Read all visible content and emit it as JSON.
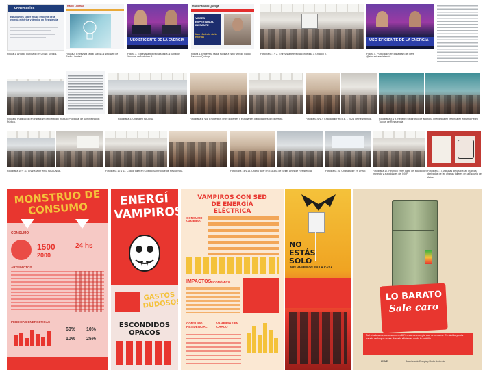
{
  "row1": {
    "captions": [
      "Figura 1. Artículo publicado en UNNE Medios.",
      "Figura 2. Entrevista radial subida al sitio web de Radio Libertad.",
      "Figura 3. Entrevista televisiva subida al canal de Youtube de Noticiero 9.",
      "Figura 4. Entrevista radial subida al sitio web de Radio Facundo Quiroga.",
      "Fotografía 1 y 2. Entrevista televisiva concedida a Chaco TV.",
      "Figura 5. Publicación en Instagram del perfil @elmundiaresistencia."
    ],
    "tv_banner": "USO EFICIENTE DE LA ENERGÍA",
    "tv_banner_2": "USO EFICIENTE DE LA ENERGÍA",
    "web_logo": "unnemedios",
    "web_headline": "Estudiantes sobre el uso eficiente de la energía eléctrica y térmica en Resistencia",
    "radio_badge": "VOCES EXPERTAS AL INSTANTE",
    "radio_headline": "Uso eficiente de la energía",
    "radio_site": "Radio Libertad",
    "radio4_site": "Radio Facundo Quiroga"
  },
  "row2": {
    "captions": [
      "Figura 6. Publicación en Instagram del perfil del Instituto Provincial de Administración Pública.",
      "Fotografía 3. Charla en FAD y U.",
      "Fotografía 4, y 5. Encuentros entre docentes y estudiantes participantes del proyecto.",
      "Fotografía 6 y 7. Charla taller en E.E.T. N°24 de Resistencia.",
      "Fotografía 8 y 9. Registro fotográfico de auditoría energética en vivienda en el barrio Pedro Turcus de Resistencia."
    ]
  },
  "row3": {
    "captions": [
      "Fotografía 10 y 11. Charla taller en la FAU UNNE.",
      "Fotografía 12 y 13. Charla taller en Colegio San Roque de Resistencia.",
      "Fotografía 14 y 15. Charla taller en Escuela de Bellas Artes de Resistencia.",
      "Fotografía 16. Charla taller en UNNE.",
      "Fotografía 17. Reunión entre parte del equipo del proyecto y autoridades del INVP.",
      "Fotografía 17. Algunas de las piezas gráficas derivadas de las charlas talleres en la Escuela de Artes."
    ]
  },
  "posters": {
    "p1_title": "MONSTRUO DE CONSUMO",
    "p1_section_a": "CONSUMO",
    "p1_stat_1": "1500",
    "p1_stat_2": "2000",
    "p1_stat_3": "24 hs",
    "p1_section_b": "ARTEFACTOS",
    "p1_section_c": "PERDIDAS ENERGETICAS",
    "p1_pct_1": "60%",
    "p1_pct_2": "10%",
    "p1_pct_3": "10%",
    "p1_pct_4": "25%",
    "p2_title": "ENERGÍ VAMPIROS",
    "p2_sub_a": "GASTOS DUDOSOS",
    "p2_sub_b": "ESCONDIDOS OPACOS",
    "p3_title": "VAMPIROS CON SED DE ENERGÍA ELÉCTRICA",
    "p3_sec_a": "CONSUMO VAMPIRO",
    "p3_sec_b": "IMPACTOS",
    "p3_sec_b2": "ECONÓMICO",
    "p3_sec_c": "CONSUMO RESIDENCIAL",
    "p3_sec_d": "VAMPIRÍAS EN CHACO",
    "p4_title": "NO ESTÁS SOLO",
    "p4_sub": "MIS VAMPIROS EN LA CASA",
    "p5_title_1": "LO BARATO",
    "p5_title_2": "Sale caro",
    "p5_body": "Tu heladera viejo consume un 80% más de energía que una nueva. Es rápido y más barato de lo que crees. Hazelo eficiente, cuida tu bolsillo.",
    "p5_footer_a": "UNNE",
    "p5_footer_b": "Secretaría de Energía y Medio Ambiente"
  },
  "colors": {
    "red": "#e8362f",
    "pink": "#f6c9c5",
    "yellow": "#f4c23b",
    "orange": "#ef8a23",
    "cream": "#ecdcc0",
    "dark": "#1d1d1d"
  }
}
